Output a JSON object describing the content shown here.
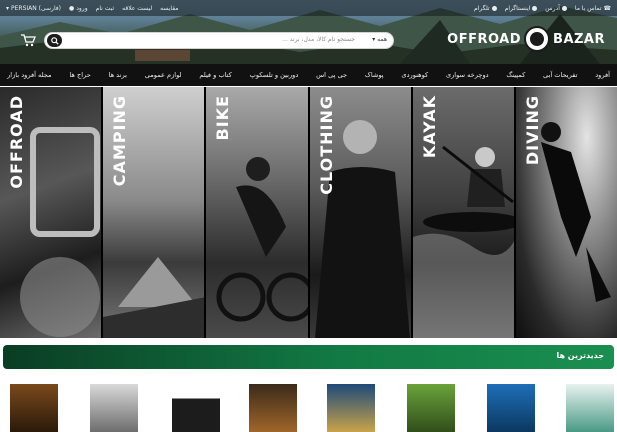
{
  "topbar": {
    "right_items": [
      {
        "label": "تماس با ما",
        "icon": "phone-icon"
      },
      {
        "label": "آدرس",
        "icon": "map-pin-icon"
      },
      {
        "label": "اینستاگرام",
        "icon": "instagram-icon"
      },
      {
        "label": "تلگرام",
        "icon": "telegram-icon"
      }
    ],
    "left_items": [
      {
        "label": "PERSIAN (فارسی)",
        "icon": "language-icon"
      },
      {
        "label": "ورود",
        "icon": "user-icon"
      },
      {
        "label": "ثبت نام"
      },
      {
        "label": "لیست علاقه"
      },
      {
        "label": "مقایسه"
      }
    ]
  },
  "logo": {
    "left_word": "OFFROAD",
    "right_word": "BAZAR"
  },
  "search": {
    "category": "همه",
    "placeholder": "جستجو نام کالا، مدل، برند ..."
  },
  "nav": {
    "items": [
      "آفرود",
      "تفریحات آبی",
      "کمپینگ",
      "دوچرخه سواری",
      "کوهنوردی",
      "پوشاک",
      "جی پی اس",
      "دوربین و تلسکوپ",
      "کتاب و فیلم",
      "لوازم عمومی",
      "برند ها",
      "حراج ها",
      "مجله آفرود بازار"
    ]
  },
  "hero": {
    "panels": [
      "OFFROAD",
      "CAMPING",
      "BIKE",
      "CLOTHING",
      "KAYAK",
      "DIVING"
    ]
  },
  "new_products": {
    "title": "جدیدترین ها"
  },
  "colors": {
    "accent_green": "#127a44",
    "nav_bg": "#111111"
  }
}
